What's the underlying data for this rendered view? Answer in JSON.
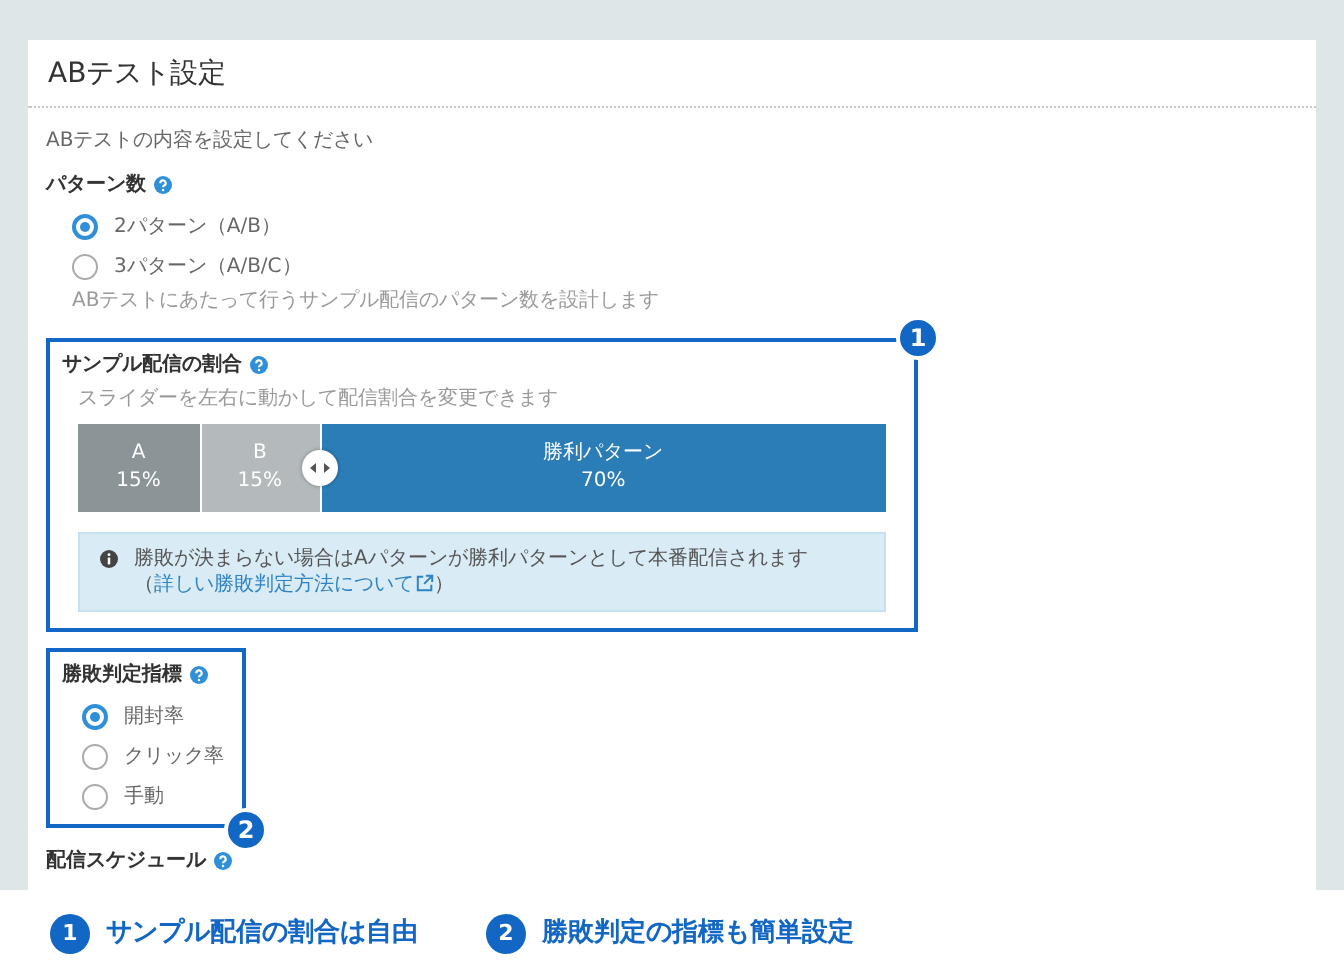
{
  "panel": {
    "title": "ABテスト設定",
    "description": "ABテストの内容を設定してください"
  },
  "pattern_count": {
    "label": "パターン数",
    "hint": "ABテストにあたって行うサンプル配信のパターン数を設計します",
    "options": [
      {
        "label": "2パターン（A/B）",
        "selected": true
      },
      {
        "label": "3パターン（A/B/C）",
        "selected": false
      }
    ]
  },
  "sample_ratio": {
    "callout": "1",
    "label": "サンプル配信の割合",
    "hint": "スライダーを左右に動かして配信割合を変更できます",
    "segments": [
      {
        "kind": "pattern",
        "label": "A",
        "value": "15%",
        "level": 0.15
      },
      {
        "kind": "pattern_light",
        "label": "B",
        "value": "15%",
        "level": 0.15
      },
      {
        "kind": "winner",
        "label": "勝利パターン",
        "value": "70%"
      }
    ],
    "info": {
      "text": "勝敗が決まらない場合はAパターンが勝利パターンとして本番配信されます",
      "open": "（",
      "link": "詳しい勝敗判定方法について",
      "close": "）"
    }
  },
  "winner_metric": {
    "callout": "2",
    "label": "勝敗判定指標",
    "options": [
      {
        "label": "開封率",
        "selected": true
      },
      {
        "label": "クリック率",
        "selected": false
      },
      {
        "label": "手動",
        "selected": false
      }
    ]
  },
  "next_section": {
    "label": "配信スケジュール"
  },
  "captions": [
    {
      "number": "1",
      "text": "サンプル配信の割合は自由"
    },
    {
      "number": "2",
      "text": "勝敗判定の指標も簡単設定"
    }
  ]
}
